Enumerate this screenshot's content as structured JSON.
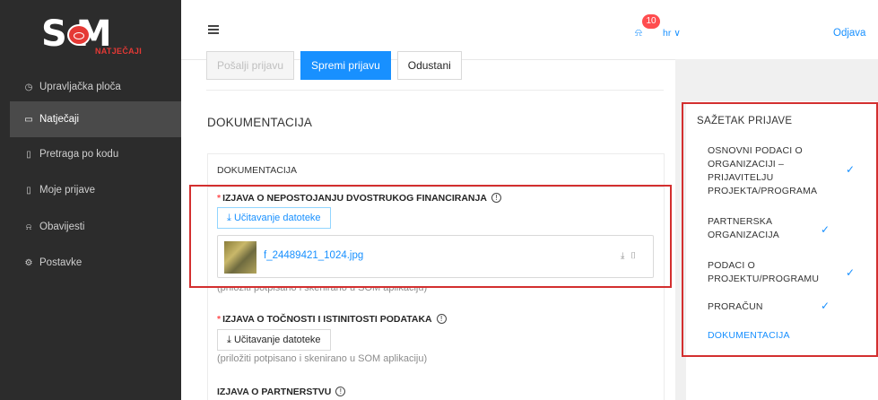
{
  "app": {
    "logo_text": "S   M",
    "logo_sub": "NATJEČAJI"
  },
  "sidebar": {
    "items": [
      {
        "label": "Upravljačka ploča",
        "icon": "dashboard-icon",
        "glyph": "◷"
      },
      {
        "label": "Natječaji",
        "icon": "folder-icon",
        "glyph": "▭"
      },
      {
        "label": "Pretraga po kodu",
        "icon": "file-icon",
        "glyph": "▯"
      },
      {
        "label": "Moje prijave",
        "icon": "document-icon",
        "glyph": "▯"
      },
      {
        "label": "Obavijesti",
        "icon": "bell-icon",
        "glyph": "⍾"
      },
      {
        "label": "Postavke",
        "icon": "gear-icon",
        "glyph": "⚙"
      }
    ]
  },
  "header": {
    "notification_count": "10",
    "language": "hr ∨",
    "logout": "Odjava"
  },
  "toolbar": {
    "submit_label": "Pošalji prijavu",
    "save_label": "Spremi prijavu",
    "cancel_label": "Odustani"
  },
  "main": {
    "section_title": "DOKUMENTACIJA",
    "card_title": "DOKUMENTACIJA",
    "fields": [
      {
        "label": "IZJAVA O NEPOSTOJANJU DVOSTRUKOG FINANCIRANJA",
        "upload_label": "Učitavanje datoteke",
        "file_name": "f_24489421_1024.jpg",
        "hint": "(priložiti potpisano i skenirano u SOM aplikaciju)"
      },
      {
        "label": "IZJAVA O TOČNOSTI I ISTINITOSTI PODATAKA",
        "upload_label": "Učitavanje datoteke",
        "hint": "(priložiti potpisano i skenirano u SOM aplikaciju)"
      },
      {
        "label": "IZJAVA O PARTNERSTVU"
      }
    ]
  },
  "summary": {
    "title": "SAŽETAK PRIJAVE",
    "items": [
      {
        "label": "OSNOVNI PODACI O ORGANIZACIJI – PRIJAVITELJU PROJEKTA/PROGRAMA",
        "done": true
      },
      {
        "label": "PARTNERSKA ORGANIZACIJA",
        "done": true
      },
      {
        "label": "PODACI O PROJEKTU/PROGRAMU",
        "done": true
      },
      {
        "label": "PRORAČUN",
        "done": true
      },
      {
        "label": "DOKUMENTACIJA",
        "done": false
      }
    ]
  },
  "colors": {
    "accent": "#1890ff",
    "sidebar": "#2c2c2c",
    "highlight": "#d32f2f",
    "required": "#ff4d4f"
  }
}
